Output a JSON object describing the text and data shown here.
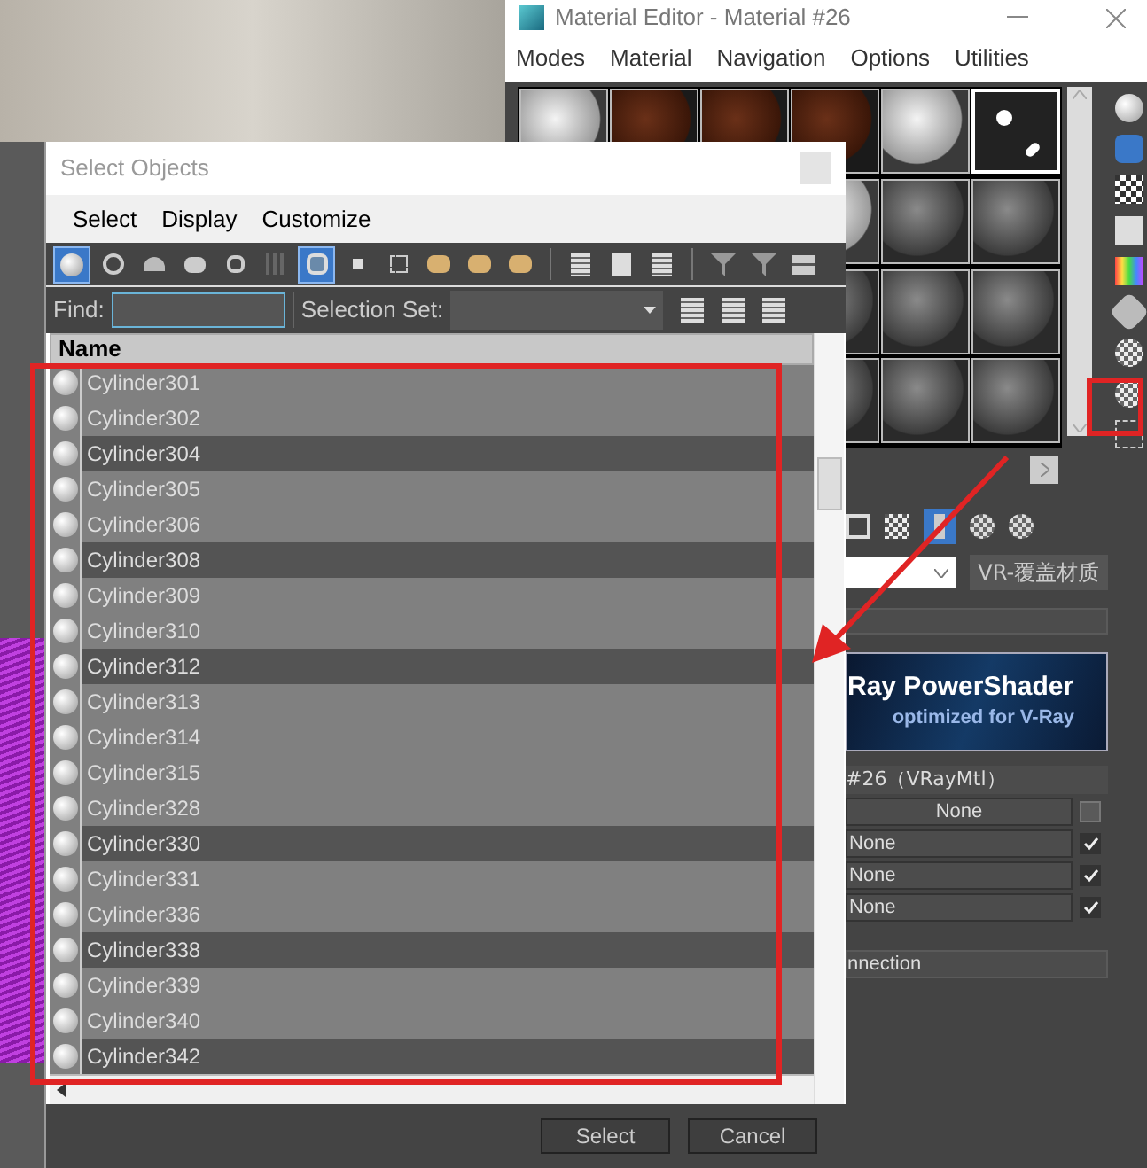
{
  "material_editor": {
    "title": "Material Editor - Material #26",
    "menu": [
      "Modes",
      "Material",
      "Navigation",
      "Options",
      "Utilities"
    ],
    "slot_rows": [
      [
        {
          "kind": "light",
          "selected": false
        },
        {
          "kind": "brown",
          "selected": false
        },
        {
          "kind": "brown",
          "selected": false
        },
        {
          "kind": "brown",
          "selected": false
        },
        {
          "kind": "light",
          "selected": false
        },
        {
          "kind": "glossy",
          "selected": true
        }
      ],
      [
        {
          "kind": "light",
          "selected": false
        },
        {
          "kind": "gray",
          "selected": false
        },
        {
          "kind": "gray",
          "selected": false
        }
      ],
      [
        {
          "kind": "gray",
          "selected": false
        },
        {
          "kind": "gray",
          "selected": false
        },
        {
          "kind": "gray",
          "selected": false
        }
      ],
      [
        {
          "kind": "gray",
          "selected": false
        },
        {
          "kind": "gray",
          "selected": false
        },
        {
          "kind": "gray",
          "selected": false
        }
      ]
    ],
    "override_button": "VR-覆盖材质",
    "banner": {
      "title": "Ray PowerShader",
      "subtitle": "optimized for V-Ray"
    },
    "material_name": "#26（VRayMtl）",
    "maps": [
      {
        "label": "None",
        "checked": false
      },
      {
        "label": "None",
        "checked": true
      },
      {
        "label": "None",
        "checked": true
      },
      {
        "label": "None",
        "checked": true
      }
    ],
    "connection": "nnection"
  },
  "dialog": {
    "title": "Select Objects",
    "menu": [
      "Select",
      "Display",
      "Customize"
    ],
    "toolbar": [
      {
        "kind": "sphere",
        "selected": true
      },
      {
        "kind": "shapes",
        "selected": false
      },
      {
        "kind": "lamp",
        "selected": false
      },
      {
        "kind": "camera",
        "selected": false
      },
      {
        "kind": "helper",
        "selected": false
      },
      {
        "kind": "grid",
        "selected": false
      },
      {
        "kind": "group",
        "selected": true
      },
      {
        "kind": "square",
        "selected": false
      },
      {
        "kind": "dots",
        "selected": false
      },
      {
        "kind": "box",
        "selected": false
      },
      {
        "kind": "box",
        "selected": false
      },
      {
        "kind": "box",
        "selected": false
      },
      {
        "kind": "separator"
      },
      {
        "kind": "list",
        "selected": false
      },
      {
        "kind": "page",
        "selected": false
      },
      {
        "kind": "list",
        "selected": false
      },
      {
        "kind": "separator"
      },
      {
        "kind": "funnel",
        "selected": false
      },
      {
        "kind": "funnel",
        "selected": false
      },
      {
        "kind": "layers",
        "selected": false
      }
    ],
    "find_label": "Find:",
    "selection_set_label": "Selection Set:",
    "column": "Name",
    "rows": [
      {
        "name": "Cylinder301",
        "selected": false
      },
      {
        "name": "Cylinder302",
        "selected": false
      },
      {
        "name": "Cylinder304",
        "selected": true
      },
      {
        "name": "Cylinder305",
        "selected": false
      },
      {
        "name": "Cylinder306",
        "selected": false
      },
      {
        "name": "Cylinder308",
        "selected": true
      },
      {
        "name": "Cylinder309",
        "selected": false
      },
      {
        "name": "Cylinder310",
        "selected": false
      },
      {
        "name": "Cylinder312",
        "selected": true
      },
      {
        "name": "Cylinder313",
        "selected": false
      },
      {
        "name": "Cylinder314",
        "selected": false
      },
      {
        "name": "Cylinder315",
        "selected": false
      },
      {
        "name": "Cylinder328",
        "selected": false
      },
      {
        "name": "Cylinder330",
        "selected": true
      },
      {
        "name": "Cylinder331",
        "selected": false
      },
      {
        "name": "Cylinder336",
        "selected": false
      },
      {
        "name": "Cylinder338",
        "selected": true
      },
      {
        "name": "Cylinder339",
        "selected": false
      },
      {
        "name": "Cylinder340",
        "selected": false
      },
      {
        "name": "Cylinder342",
        "selected": true
      }
    ],
    "buttons": [
      "Select",
      "Cancel"
    ]
  }
}
